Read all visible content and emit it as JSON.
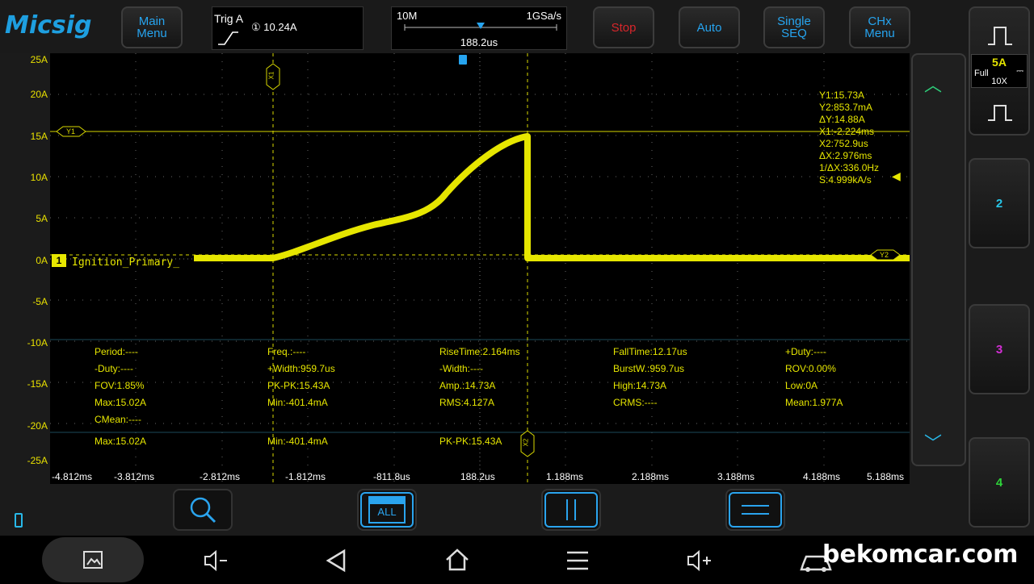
{
  "brand": "Micsig",
  "toolbar": {
    "main_menu": [
      "Main",
      "Menu"
    ],
    "stop": "Stop",
    "auto": "Auto",
    "single_seq": [
      "Single",
      "SEQ"
    ],
    "chx_menu": [
      "CHx",
      "Menu"
    ]
  },
  "trigger": {
    "title": "Trig A",
    "channel_mark": "①",
    "level": "10.24A"
  },
  "timebase": {
    "memory": "10M",
    "sample_rate": "1GSa/s",
    "position": "188.2us"
  },
  "channel1": {
    "marker": "1",
    "label": "Ignition_Primary_",
    "scale": "5A",
    "coupling": "Full",
    "probe": "10X"
  },
  "y_axis_labels": [
    "25A",
    "20A",
    "15A",
    "10A",
    "5A",
    "0A",
    "-5A",
    "-10A",
    "-15A",
    "-20A",
    "-25A"
  ],
  "x_axis_labels": [
    "-4.812ms",
    "-3.812ms",
    "-2.812ms",
    "-1.812ms",
    "-811.8us",
    "188.2us",
    "1.188ms",
    "2.188ms",
    "3.188ms",
    "4.188ms",
    "5.188ms"
  ],
  "cursors": {
    "x1_tag": "X1",
    "x2_tag": "X2",
    "y1_tag": "Y1",
    "y2_tag": "Y2",
    "readout": [
      "Y1:15.73A",
      "Y2:853.7mA",
      "ΔY:14.88A",
      "X1:-2.224ms",
      "X2:752.9us",
      "ΔX:2.976ms",
      "1/ΔX:336.0Hz",
      "S:4.999kA/s"
    ]
  },
  "measurements": {
    "col1": [
      "Period:----",
      "-Duty:----",
      "FOV:1.85%",
      "Max:15.02A",
      "CMean:----"
    ],
    "col2": [
      "Freq.:----",
      "+Width:959.7us",
      "PK-PK:15.43A",
      "Min:-401.4mA"
    ],
    "col3": [
      "RiseTime:2.164ms",
      "-Width:----",
      "Amp.:14.73A",
      "RMS:4.127A"
    ],
    "col4": [
      "FallTime:12.17us",
      "BurstW.:959.7us",
      "High:14.73A",
      "CRMS:----"
    ],
    "col5": [
      "+Duty:----",
      "ROV:0.00%",
      "Low:0A",
      "Mean:1.977A"
    ],
    "stats": [
      "Max:15.02A",
      "Min:-401.4mA",
      "PK-PK:15.43A"
    ]
  },
  "channels": {
    "ch2": "2",
    "ch3": "3",
    "ch4": "4"
  },
  "bottom_tools": {
    "all_label": "ALL"
  },
  "watermark": "bekomcar.com",
  "colors": {
    "trace": "#e6e600",
    "accent": "#26a4ef",
    "stop": "#d8262b",
    "ch2": "#27c6e8",
    "ch3": "#d22ed4",
    "ch4": "#2ed43a"
  },
  "icons": [
    "zoom-icon",
    "all-measure-icon",
    "x-cursor-icon",
    "y-cursor-icon",
    "battery-icon",
    "screenshot-icon",
    "volume-down-icon",
    "back-icon",
    "home-icon",
    "menu-icon",
    "volume-up-icon",
    "car-icon"
  ]
}
